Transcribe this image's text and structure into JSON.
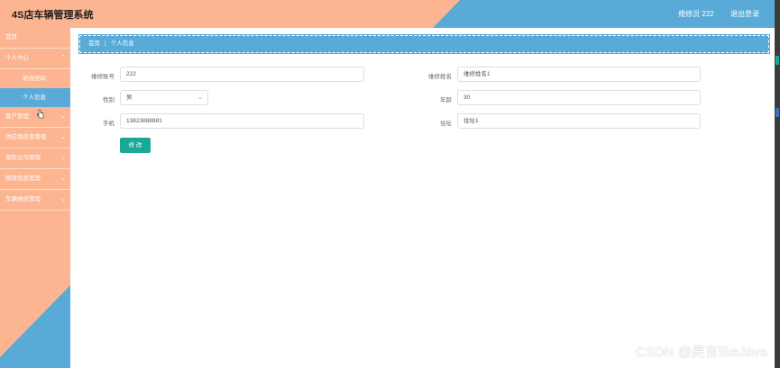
{
  "colors": {
    "peach": "#fcb590",
    "blue": "#5aaad8",
    "teal": "#19a897"
  },
  "header": {
    "title": "4S店车辆管理系统",
    "user_label": "维修员 222",
    "logout_label": "退出登录"
  },
  "sidebar": {
    "items": [
      {
        "label": "首页"
      },
      {
        "label": "个人中心"
      },
      {
        "label": "修改密码"
      },
      {
        "label": "个人信息"
      },
      {
        "label": "客户管理"
      },
      {
        "label": "供应商信息管理"
      },
      {
        "label": "保险公司管理"
      },
      {
        "label": "物资信息管理"
      },
      {
        "label": "车辆维修管理"
      }
    ]
  },
  "breadcrumb": {
    "home": "首页",
    "current": "个人信息"
  },
  "form": {
    "repair_no": {
      "label": "维修账号",
      "value": "222"
    },
    "repair_name": {
      "label": "维修姓名",
      "value": "维修姓名1"
    },
    "gender": {
      "label": "性别",
      "value": "男"
    },
    "age": {
      "label": "年龄",
      "value": "30"
    },
    "phone": {
      "label": "手机",
      "value": "13823888881"
    },
    "address": {
      "label": "住址",
      "value": "住址1"
    },
    "submit_label": "修 改"
  },
  "watermark": "CSDN @昊言likeJava"
}
